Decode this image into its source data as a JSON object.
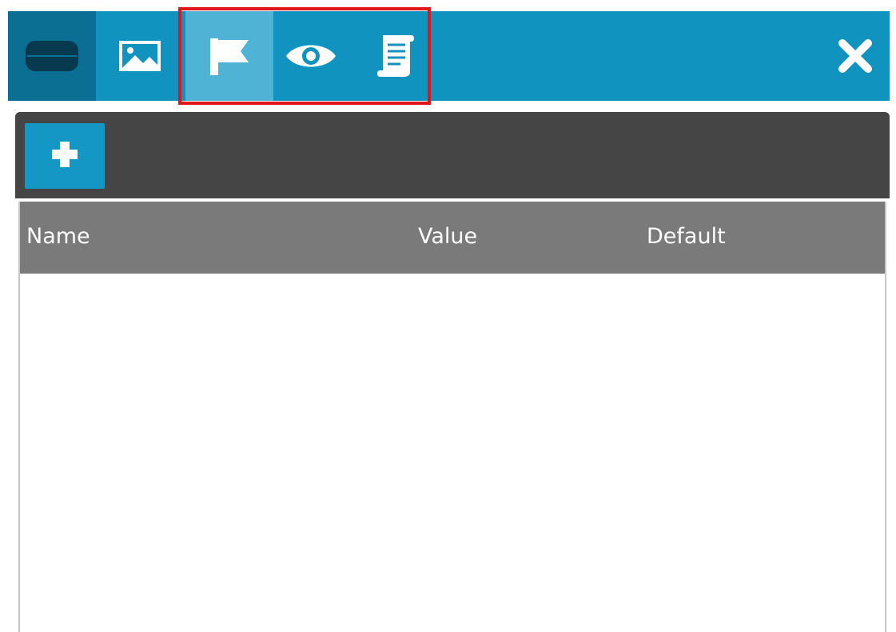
{
  "tabs": [
    {
      "icon": "device-icon",
      "active": false
    },
    {
      "icon": "image-icon",
      "active": false
    },
    {
      "icon": "flag-icon",
      "active": true
    },
    {
      "icon": "eye-icon",
      "active": false
    },
    {
      "icon": "script-icon",
      "active": false
    }
  ],
  "toolbar": {
    "add_icon": "plus-icon"
  },
  "table": {
    "columns": [
      "Name",
      "Value",
      "Default"
    ],
    "rows": []
  },
  "colors": {
    "accent": "#1093bf",
    "active_tab": "#4eb3d5",
    "highlight": "#e0161b",
    "toolbar": "#454545",
    "table_header": "#7a7a7a"
  }
}
